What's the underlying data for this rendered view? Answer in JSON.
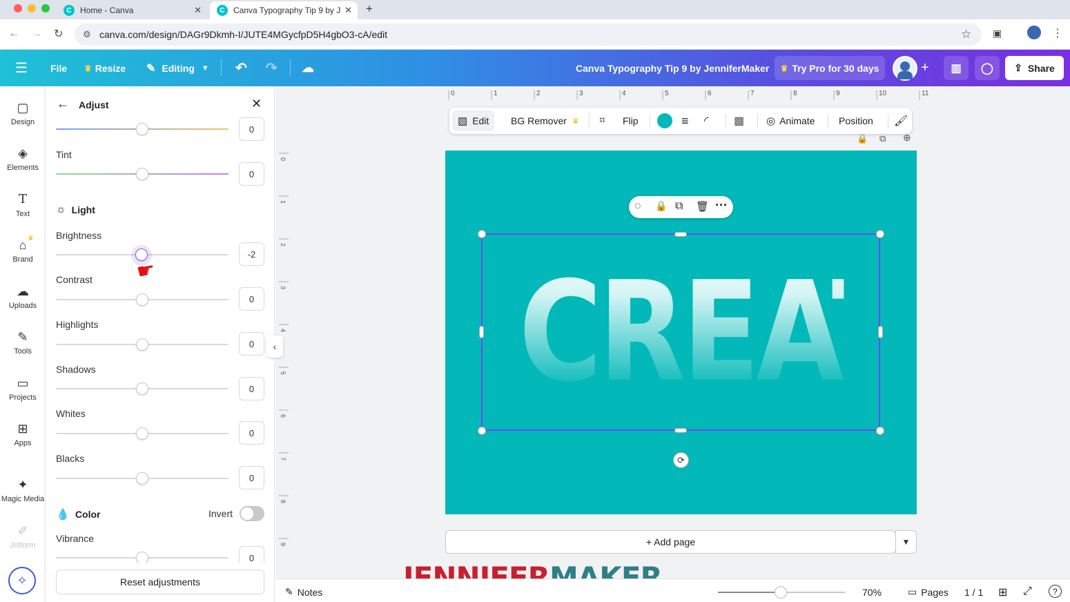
{
  "browser": {
    "tabs": [
      {
        "title": "Home - Canva",
        "active": false
      },
      {
        "title": "Canva Typography Tip 9 by J",
        "active": true
      }
    ],
    "new_tab": "+",
    "url": "canva.com/design/DAGr9Dkmh-I/JUTE4MGycfpD5H4gbO3-cA/edit"
  },
  "header": {
    "file": "File",
    "resize": "Resize",
    "editing": "Editing",
    "doc_title": "Canva Typography Tip 9 by JenniferMaker",
    "try_pro": "Try Pro for 30 days",
    "share": "Share",
    "add_member": "+"
  },
  "rail": {
    "items": [
      {
        "label": "Design",
        "icon": "design-icon"
      },
      {
        "label": "Elements",
        "icon": "elements-icon"
      },
      {
        "label": "Text",
        "icon": "text-icon"
      },
      {
        "label": "Brand",
        "icon": "brand-icon"
      },
      {
        "label": "Uploads",
        "icon": "uploads-icon"
      },
      {
        "label": "Tools",
        "icon": "tools-icon"
      },
      {
        "label": "Projects",
        "icon": "projects-icon"
      },
      {
        "label": "Apps",
        "icon": "apps-icon"
      },
      {
        "label": "Magic Media",
        "icon": "magic-media-icon"
      },
      {
        "label": "Jotform",
        "icon": "jotform-icon"
      }
    ]
  },
  "panel": {
    "title": "Adjust",
    "top_value": "0",
    "tint": {
      "label": "Tint",
      "value": "0"
    },
    "light_heading": "Light",
    "sliders": [
      {
        "label": "Brightness",
        "value": "-2"
      },
      {
        "label": "Contrast",
        "value": "0"
      },
      {
        "label": "Highlights",
        "value": "0"
      },
      {
        "label": "Shadows",
        "value": "0"
      },
      {
        "label": "Whites",
        "value": "0"
      },
      {
        "label": "Blacks",
        "value": "0"
      }
    ],
    "color_heading": "Color",
    "invert_label": "Invert",
    "vibrance": {
      "label": "Vibrance",
      "value": "0"
    },
    "reset": "Reset adjustments"
  },
  "ruler": {
    "horizontal": [
      "0",
      "1",
      "2",
      "3",
      "4",
      "5",
      "6",
      "7",
      "8",
      "9",
      "10",
      "11"
    ],
    "vertical": [
      "0",
      "1",
      "2",
      "3",
      "4",
      "5",
      "6",
      "7",
      "8",
      "9"
    ]
  },
  "toolbar": {
    "edit": "Edit",
    "bg_remover": "BG Remover",
    "flip": "Flip",
    "animate": "Animate",
    "position": "Position",
    "color_swatch": "#03b8b8"
  },
  "canvas": {
    "text": "CREATE",
    "background": "#03b8b8",
    "add_page": "+ Add page"
  },
  "bottom": {
    "notes": "Notes",
    "zoom": "70%",
    "pages": "Pages",
    "page_count": "1 / 1",
    "help": "?"
  },
  "watermark": {
    "part1": "JENNIFER",
    "part2": "MAKER",
    "color1": "#c8202f",
    "color2": "#2f7f86"
  }
}
